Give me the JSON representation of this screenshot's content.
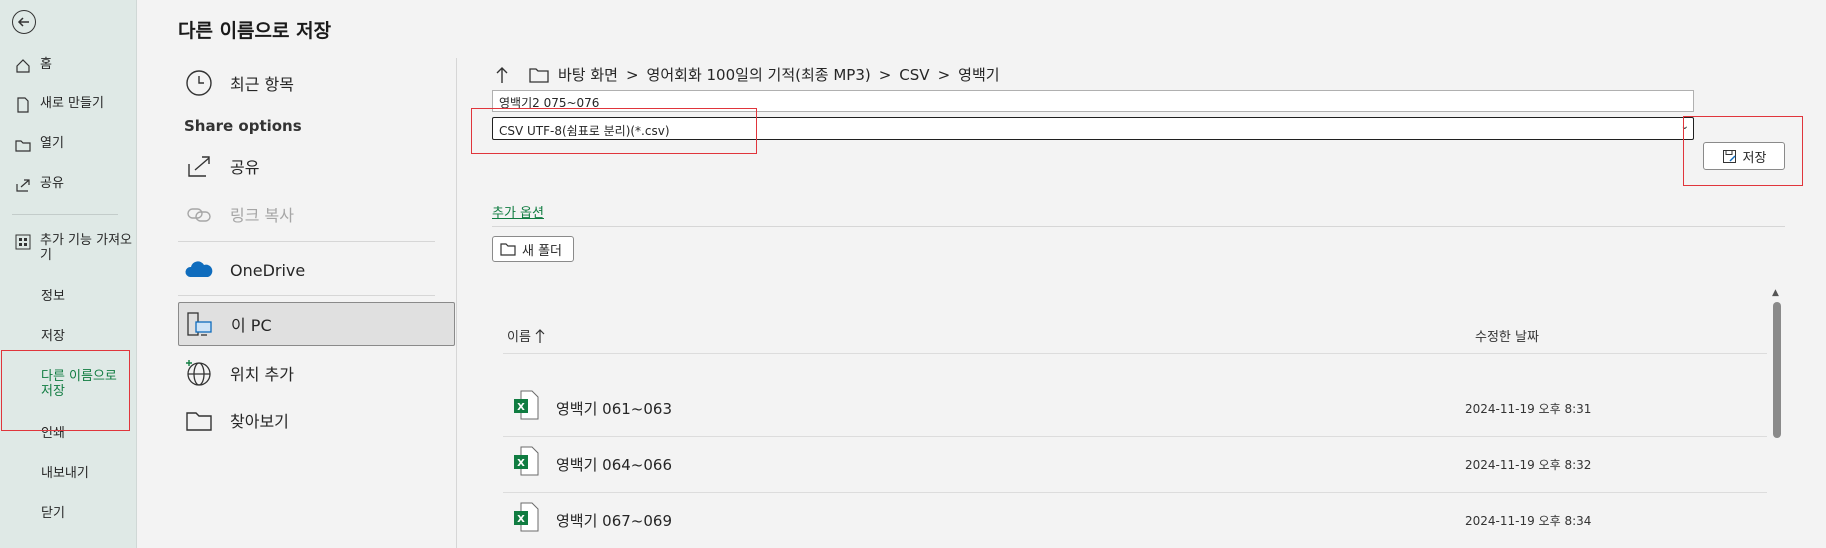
{
  "title": "다른 이름으로 저장",
  "nav": {
    "home": "홈",
    "new": "새로 만들기",
    "open": "열기",
    "share": "공유",
    "addins": "추가 기능 가져오기",
    "info": "정보",
    "save": "저장",
    "save_as": "다른 이름으로 저장",
    "print": "인쇄",
    "export": "내보내기",
    "close": "닫기"
  },
  "locations": {
    "recent": "최근 항목",
    "share_options_header": "Share options",
    "share": "공유",
    "copy_link": "링크 복사",
    "onedrive": "OneDrive",
    "this_pc": "이 PC",
    "add_place": "위치 추가",
    "browse": "찾아보기"
  },
  "breadcrumb": [
    "바탕 화면",
    "영어회화 100일의 기적(최종 MP3)",
    "CSV",
    "영백기"
  ],
  "breadcrumb_sep": ">",
  "file_name": "영백기2 075~076",
  "file_type": "CSV UTF-8(쉼표로 분리)(*.csv)",
  "save_button": "저장",
  "more_options": "추가 옵션",
  "new_folder": "새 폴더",
  "columns": {
    "name": "이름",
    "modified": "수정한 날짜"
  },
  "files": [
    {
      "name": "영백기 061~063",
      "date": "2024-11-19 오후 8:31"
    },
    {
      "name": "영백기 064~066",
      "date": "2024-11-19 오후 8:32"
    },
    {
      "name": "영백기 067~069",
      "date": "2024-11-19 오후 8:34"
    }
  ],
  "colors": {
    "accent": "#107c41",
    "highlight_box": "#e0353b",
    "nav_bg": "#dfe9e6"
  }
}
